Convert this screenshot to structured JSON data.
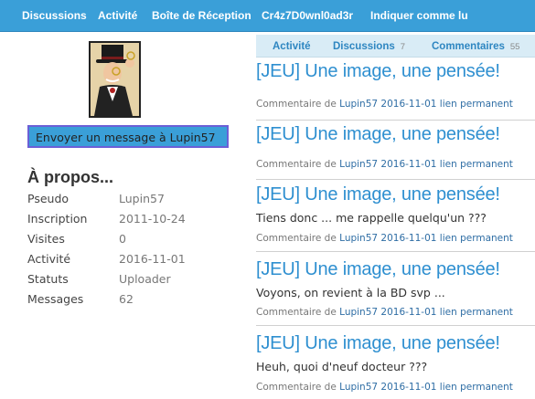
{
  "nav": {
    "items": [
      "Discussions",
      "Activité",
      "Boîte de Réception",
      "Cr4z7D0wnl0ad3r",
      "Indiquer comme lu"
    ]
  },
  "profile": {
    "avatar_icon": "monocle-gentleman-avatar",
    "send_message_label": "Envoyer un message à Lupin57",
    "about_title": "À propos...",
    "fields": [
      {
        "label": "Pseudo",
        "value": "Lupin57"
      },
      {
        "label": "Inscription",
        "value": "2011-10-24"
      },
      {
        "label": "Visites",
        "value": "0"
      },
      {
        "label": "Activité",
        "value": "2016-11-01"
      },
      {
        "label": "Statuts",
        "value": "Uploader"
      },
      {
        "label": "Messages",
        "value": "62"
      }
    ]
  },
  "tabs": {
    "activity": {
      "label": "Activité"
    },
    "discussions": {
      "label": "Discussions",
      "count": "7"
    },
    "comments": {
      "label": "Commentaires",
      "count": "55"
    }
  },
  "comments": [
    {
      "title": "[JEU] Une image, une pensée!",
      "body": "",
      "meta_prefix": "Commentaire de",
      "author": "Lupin57",
      "date": "2016-11-01",
      "link": "lien permanent"
    },
    {
      "title": "[JEU] Une image, une pensée!",
      "body": "",
      "meta_prefix": "Commentaire de",
      "author": "Lupin57",
      "date": "2016-11-01",
      "link": "lien permanent"
    },
    {
      "title": "[JEU] Une image, une pensée!",
      "body": "Tiens donc ... me rappelle quelqu'un ???",
      "meta_prefix": "Commentaire de",
      "author": "Lupin57",
      "date": "2016-11-01",
      "link": "lien permanent"
    },
    {
      "title": "[JEU] Une image, une pensée!",
      "body": "Voyons, on revient à la BD svp ...",
      "meta_prefix": "Commentaire de",
      "author": "Lupin57",
      "date": "2016-11-01",
      "link": "lien permanent"
    },
    {
      "title": "[JEU] Une image, une pensée!",
      "body": "Heuh, quoi d'neuf docteur ???",
      "meta_prefix": "Commentaire de",
      "author": "Lupin57",
      "date": "2016-11-01",
      "link": "lien permanent"
    }
  ],
  "colors": {
    "nav_bg": "#3a9fd8",
    "link": "#2e8fd0",
    "tab_bg": "#d9ecf6"
  }
}
